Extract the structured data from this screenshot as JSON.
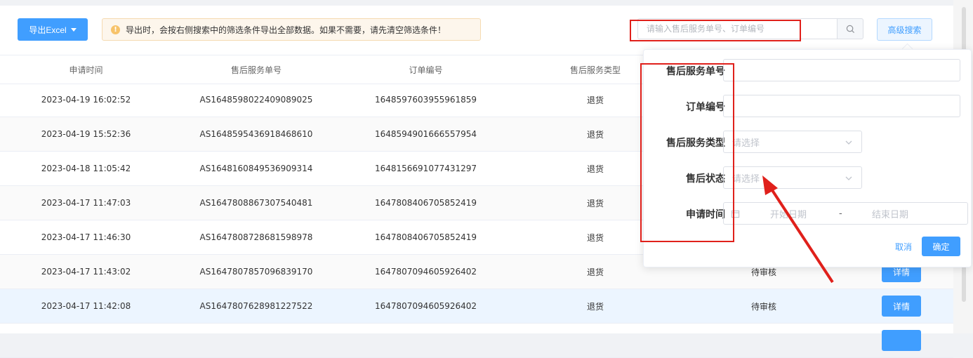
{
  "toolbar": {
    "export_label": "导出Excel",
    "notice_text": "导出时，会按右侧搜索中的筛选条件导出全部数据。如果不需要，请先清空筛选条件！",
    "search_placeholder": "请输入售后服务单号、订单编号",
    "advanced_search_label": "高级搜索"
  },
  "table": {
    "headers": [
      "申请时间",
      "售后服务单号",
      "订单编号",
      "售后服务类型"
    ],
    "rows": [
      {
        "time": "2023-04-19 16:02:52",
        "service_no": "AS1648598022409089025",
        "order_no": "1648597603955961859",
        "type": "退货",
        "status": "",
        "action": ""
      },
      {
        "time": "2023-04-19 15:52:36",
        "service_no": "AS1648595436918468610",
        "order_no": "1648594901666557954",
        "type": "退货",
        "status": "",
        "action": ""
      },
      {
        "time": "2023-04-18 11:05:42",
        "service_no": "AS1648160849536909314",
        "order_no": "1648156691077431297",
        "type": "退货",
        "status": "",
        "action": ""
      },
      {
        "time": "2023-04-17 11:47:03",
        "service_no": "AS1647808867307540481",
        "order_no": "1647808406705852419",
        "type": "退货",
        "status": "",
        "action": ""
      },
      {
        "time": "2023-04-17 11:46:30",
        "service_no": "AS1647808728681598978",
        "order_no": "1647808406705852419",
        "type": "退货",
        "status": "",
        "action": ""
      },
      {
        "time": "2023-04-17 11:43:02",
        "service_no": "AS1647807857096839170",
        "order_no": "1647807094605926402",
        "type": "退货",
        "status": "待审核",
        "action": "详情"
      },
      {
        "time": "2023-04-17 11:42:08",
        "service_no": "AS1647807628981227522",
        "order_no": "1647807094605926402",
        "type": "退货",
        "status": "待审核",
        "action": "详情"
      }
    ]
  },
  "advanced_form": {
    "service_no_label": "售后服务单号",
    "order_no_label": "订单编号",
    "service_type_label": "售后服务类型",
    "service_type_placeholder": "请选择",
    "status_label": "售后状态",
    "status_placeholder": "请选择",
    "apply_time_label": "申请时间",
    "start_date_placeholder": "开始日期",
    "date_separator": "-",
    "end_date_placeholder": "结束日期",
    "cancel_label": "取消",
    "confirm_label": "确定"
  },
  "icons": {
    "export_caret": "caret-down-icon",
    "notice": "info-icon",
    "search": "search-icon",
    "select_chevron": "chevron-down-icon",
    "calendar": "calendar-icon"
  },
  "colors": {
    "primary": "#409eff",
    "annotation_red": "#e0201b",
    "notice_bg": "#fdf6ec"
  }
}
